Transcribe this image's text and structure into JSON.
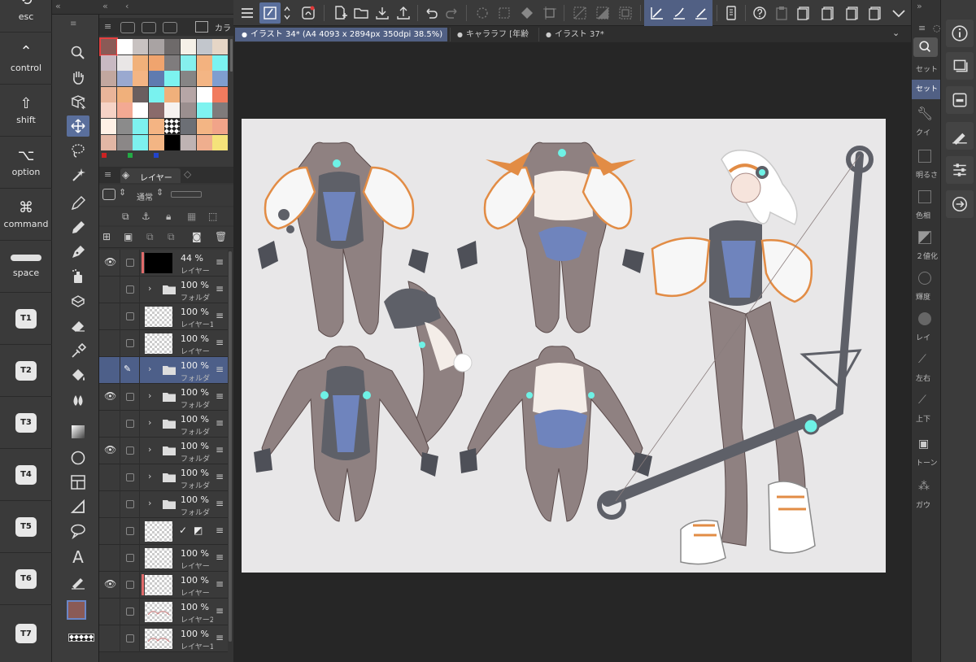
{
  "modifier_keys": [
    {
      "label": "esc",
      "icon": "esc-key-icon",
      "sym": "⟲"
    },
    {
      "label": "control",
      "icon": "control-key-icon",
      "sym": "⌃"
    },
    {
      "label": "shift",
      "icon": "shift-key-icon",
      "sym": "⇧"
    },
    {
      "label": "option",
      "icon": "option-key-icon",
      "sym": "⌥"
    },
    {
      "label": "command",
      "icon": "command-key-icon",
      "sym": "⌘"
    },
    {
      "label": "space",
      "icon": "space-key-icon",
      "sym": ""
    }
  ],
  "t_keys": [
    "T1",
    "T2",
    "T3",
    "T4",
    "T5",
    "T6",
    "T7"
  ],
  "palette": {
    "tab_label": "カラ",
    "colors": [
      "#8a5a56",
      "#ffffff",
      "#c8c2c1",
      "#a9a3a3",
      "#6e6a6a",
      "#f5f1e8",
      "#c2c6cc",
      "#e6d6c6",
      "#c8b9c2",
      "#e9e6e6",
      "#f1b17a",
      "#f0a46e",
      "#7f7c7d",
      "#85f0ee",
      "#f3b27f",
      "#7bf3f1",
      "#c2a79f",
      "#9aa9d0",
      "#f3b584",
      "#5f7bb0",
      "#7cf3ef",
      "#868585",
      "#f3b584",
      "#7f9ed0",
      "#e9b59a",
      "#f0b07b",
      "#6a5f5f",
      "#79f2ef",
      "#f0b07b",
      "#b6a6a6",
      "#ffffff",
      "#f17b5e",
      "#f6d3c6",
      "#f3a993",
      "#ffffff",
      "#8a6b6b",
      "#f6f2f0",
      "#9b8f8f",
      "#7ff3f0",
      "#7f7b7b",
      "#fff1e6",
      "#8b8b8b",
      "#7df1ee",
      "#f4b483",
      "#cccccc",
      "#6c6f75",
      "#f3b584",
      "#f1a489",
      "#e2b7a5",
      "#8b8787",
      "#7df1ee",
      "#f3b584",
      "#000000",
      "#bfb3b3",
      "#efae8e",
      "#f5e27a"
    ],
    "indicator_colors": [
      "#cc2222",
      "#22aa44",
      "#2244cc"
    ]
  },
  "layer_panel": {
    "tab_label": "レイヤー",
    "blend_mode": "通常",
    "layers": [
      {
        "visible": true,
        "opacity": "44 %",
        "name": "レイヤー",
        "type": "black",
        "clipped": true,
        "icon": ""
      },
      {
        "visible": false,
        "opacity": "100 %",
        "name": "フォルダ",
        "type": "folder",
        "clipped": false,
        "icon": ""
      },
      {
        "visible": false,
        "opacity": "100 %",
        "name": "レイヤー1",
        "type": "raster",
        "clipped": false,
        "icon": ""
      },
      {
        "visible": false,
        "opacity": "100 %",
        "name": "レイヤー",
        "type": "raster",
        "clipped": false,
        "icon": ""
      },
      {
        "visible": false,
        "opacity": "100 %",
        "name": "フォルダ",
        "type": "folder",
        "clipped": false,
        "icon": "pen",
        "selected": true
      },
      {
        "visible": true,
        "opacity": "100 %",
        "name": "フォルダ",
        "type": "folder",
        "clipped": false,
        "icon": ""
      },
      {
        "visible": false,
        "opacity": "100 %",
        "name": "フォルダ",
        "type": "folder",
        "clipped": false,
        "icon": ""
      },
      {
        "visible": true,
        "opacity": "100 %",
        "name": "フォルダ",
        "type": "folder",
        "clipped": false,
        "icon": ""
      },
      {
        "visible": false,
        "opacity": "100 %",
        "name": "フォルダ",
        "type": "folder",
        "clipped": false,
        "icon": ""
      },
      {
        "visible": false,
        "opacity": "100 %",
        "name": "フォルダ",
        "type": "folder",
        "clipped": false,
        "icon": ""
      },
      {
        "visible": false,
        "opacity": "",
        "name": "",
        "type": "raster-check",
        "clipped": false,
        "icon": ""
      },
      {
        "visible": false,
        "opacity": "100 %",
        "name": "レイヤー",
        "type": "raster",
        "clipped": false,
        "icon": ""
      },
      {
        "visible": true,
        "opacity": "100 %",
        "name": "レイヤー",
        "type": "raster",
        "clipped": true,
        "icon": ""
      },
      {
        "visible": false,
        "opacity": "100 %",
        "name": "レイヤー2",
        "type": "sketch",
        "clipped": false,
        "icon": ""
      },
      {
        "visible": false,
        "opacity": "100 %",
        "name": "レイヤー1",
        "type": "sketch",
        "clipped": false,
        "icon": ""
      }
    ]
  },
  "tabs": [
    {
      "label": "イラスト 34* (A4 4093 x 2894px 350dpi 38.5%)",
      "active": true
    },
    {
      "label": "キャララフ [年齢",
      "active": false
    },
    {
      "label": "イラスト 37*",
      "active": false
    }
  ],
  "right_panel_items": [
    "セット",
    "セット",
    "クイ",
    "明るさ",
    "色相",
    "２値化",
    "輝度",
    "レイ",
    "左右",
    "上下",
    "トーン",
    "ガウ"
  ],
  "colors": {
    "accent": "#5a6f9c",
    "main_color": "#8a5a56",
    "sub_color": "#ffffff",
    "canvas_bg": "#e8e7e8"
  }
}
